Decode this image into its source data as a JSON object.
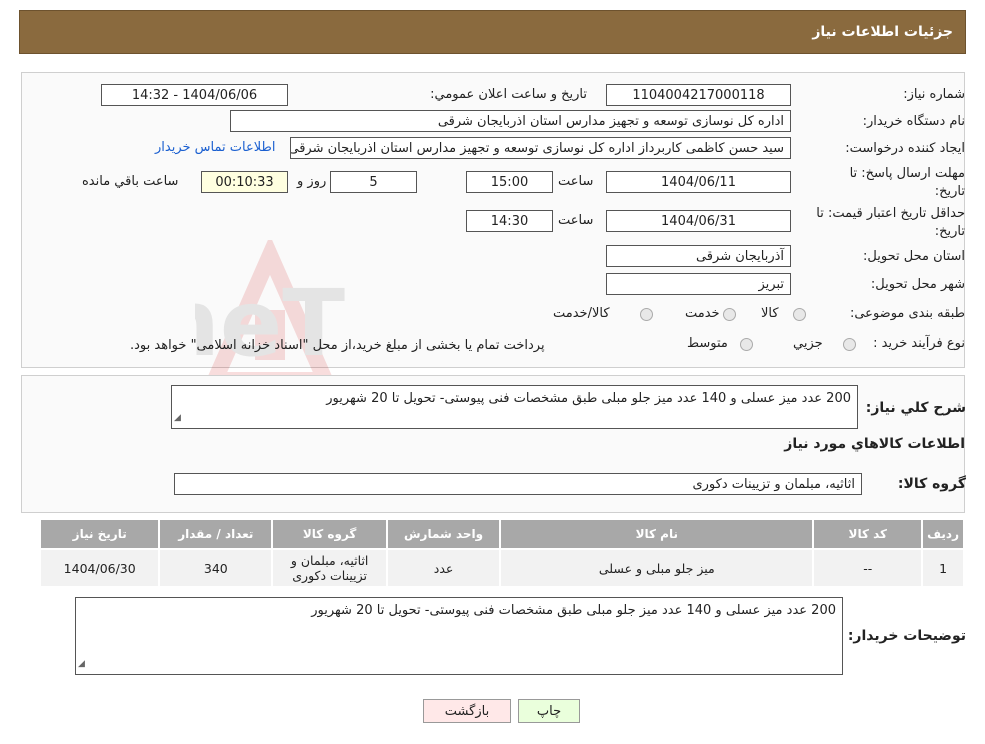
{
  "header": {
    "title": "جزئیات اطلاعات نیاز"
  },
  "form": {
    "need_number_label": "شماره نیاز:",
    "need_number": "1104004217000118",
    "announce_label": "تاريخ و ساعت اعلان عمومي:",
    "announce_value": "1404/06/06 - 14:32",
    "buyer_label": "نام دستگاه خريدار:",
    "buyer_value": "اداره کل نوسازی  توسعه و تجهیز مدارس استان اذربایجان شرقی",
    "creator_label": "ایجاد کننده درخواست:",
    "creator_value": "سید حسن کاظمی کاربرداز اداره کل نوسازی  توسعه و تجهیز مدارس استان اذربایجان شرقی",
    "contact_link": "اطلاعات تماس خریدار",
    "deadline_label_1": "مهلت ارسال پاسخ: تا",
    "deadline_label_2": "تاریخ:",
    "deadline_date": "1404/06/11",
    "time_label": "ساعت",
    "deadline_time": "15:00",
    "days_value": "5",
    "days_label": "روز و",
    "remaining_value": "00:10:33",
    "remaining_label": "ساعت باقي مانده",
    "validity_label_1": "حداقل تاریخ اعتبار قیمت: تا",
    "validity_label_2": "تاریخ:",
    "validity_date": "1404/06/31",
    "validity_time": "14:30",
    "province_label": "استان محل تحویل:",
    "province_value": "آذربایجان شرقی",
    "city_label": "شهر محل تحویل:",
    "city_value": "تبریز",
    "category_label": "طبقه بندی موضوعی:",
    "category_options": [
      "کالا",
      "خدمت",
      "کالا/خدمت"
    ],
    "process_label": "نوع فرآیند خرید :",
    "process_options": [
      "جزیي",
      "متوسط"
    ],
    "process_note": "پرداخت تمام یا بخشی از مبلغ خرید،از محل \"اسناد خزانه اسلامی\" خواهد بود."
  },
  "summary": {
    "label": "شرح کلي نياز:",
    "text": "200 عدد میز عسلی و 140 عدد میز جلو مبلی طبق مشخصات فنی پیوستی- تحویل تا 20 شهریور",
    "items_title": "اطلاعات کالاهاي مورد نياز",
    "group_label": "گروه کالا:",
    "group_value": "اثاثیه، مبلمان و تزیینات دکوری"
  },
  "table": {
    "headers": [
      "رديف",
      "کد کالا",
      "نام کالا",
      "واحد شمارش",
      "گروه کالا",
      "تعداد / مقدار",
      "تاريخ نياز"
    ],
    "rows": [
      {
        "row": "1",
        "code": "--",
        "name": "میز جلو مبلی و عسلی",
        "unit": "عدد",
        "group": "اثاثیه، مبلمان و تزیینات دکوری",
        "qty": "340",
        "date": "1404/06/30"
      }
    ]
  },
  "buyer_notes": {
    "label": "توضیحات خریدار:",
    "text": "200 عدد میز عسلی و 140 عدد میز جلو مبلی طبق مشخصات فنی پیوستی- تحویل تا 20 شهریور"
  },
  "buttons": {
    "print": "چاپ",
    "back": "بازگشت"
  },
  "colors": {
    "header_bg": "#8a6a3e",
    "table_header": "#a8a8a8",
    "print_bg": "#eaffdc",
    "back_bg": "#ffe8e8",
    "link": "#1a5fd0"
  }
}
